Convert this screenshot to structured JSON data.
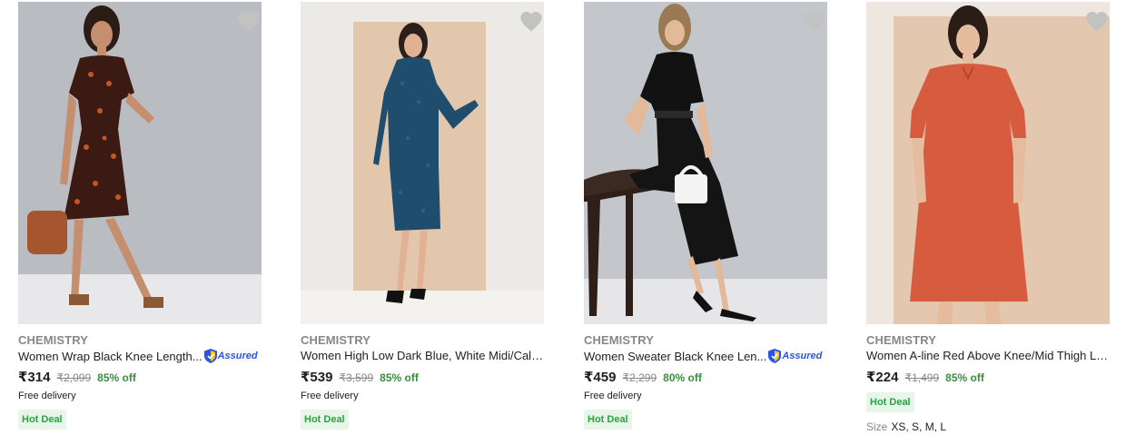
{
  "products": [
    {
      "brand": "CHEMISTRY",
      "title": "Women Wrap Black Knee Length...",
      "assured": true,
      "assured_label": "Assured",
      "price": "₹314",
      "mrp": "₹2,099",
      "discount": "85% off",
      "delivery": "Free delivery",
      "deal": "Hot Deal"
    },
    {
      "brand": "CHEMISTRY",
      "title": "Women High Low Dark Blue, White Midi/Calf ...",
      "assured": false,
      "price": "₹539",
      "mrp": "₹3,599",
      "discount": "85% off",
      "delivery": "Free delivery",
      "deal": "Hot Deal"
    },
    {
      "brand": "CHEMISTRY",
      "title": "Women Sweater Black Knee Len...",
      "assured": true,
      "assured_label": "Assured",
      "price": "₹459",
      "mrp": "₹2,299",
      "discount": "80% off",
      "delivery": "Free delivery",
      "deal": "Hot Deal"
    },
    {
      "brand": "CHEMISTRY",
      "title": "Women A-line Red Above Knee/Mid Thigh Le...",
      "assured": false,
      "price": "₹224",
      "mrp": "₹1,499",
      "discount": "85% off",
      "deal": "Hot Deal",
      "size_label": "Size",
      "sizes": "XS, S, M, L"
    }
  ],
  "icons": {
    "wishlist": "heart-icon",
    "assured": "shield-icon"
  },
  "colors": {
    "discount": "#388e3c",
    "deal_bg": "#e8f5e9",
    "deal_text": "#26a541",
    "assured": "#2a55e5",
    "wishlist": "#c2c2c2"
  }
}
